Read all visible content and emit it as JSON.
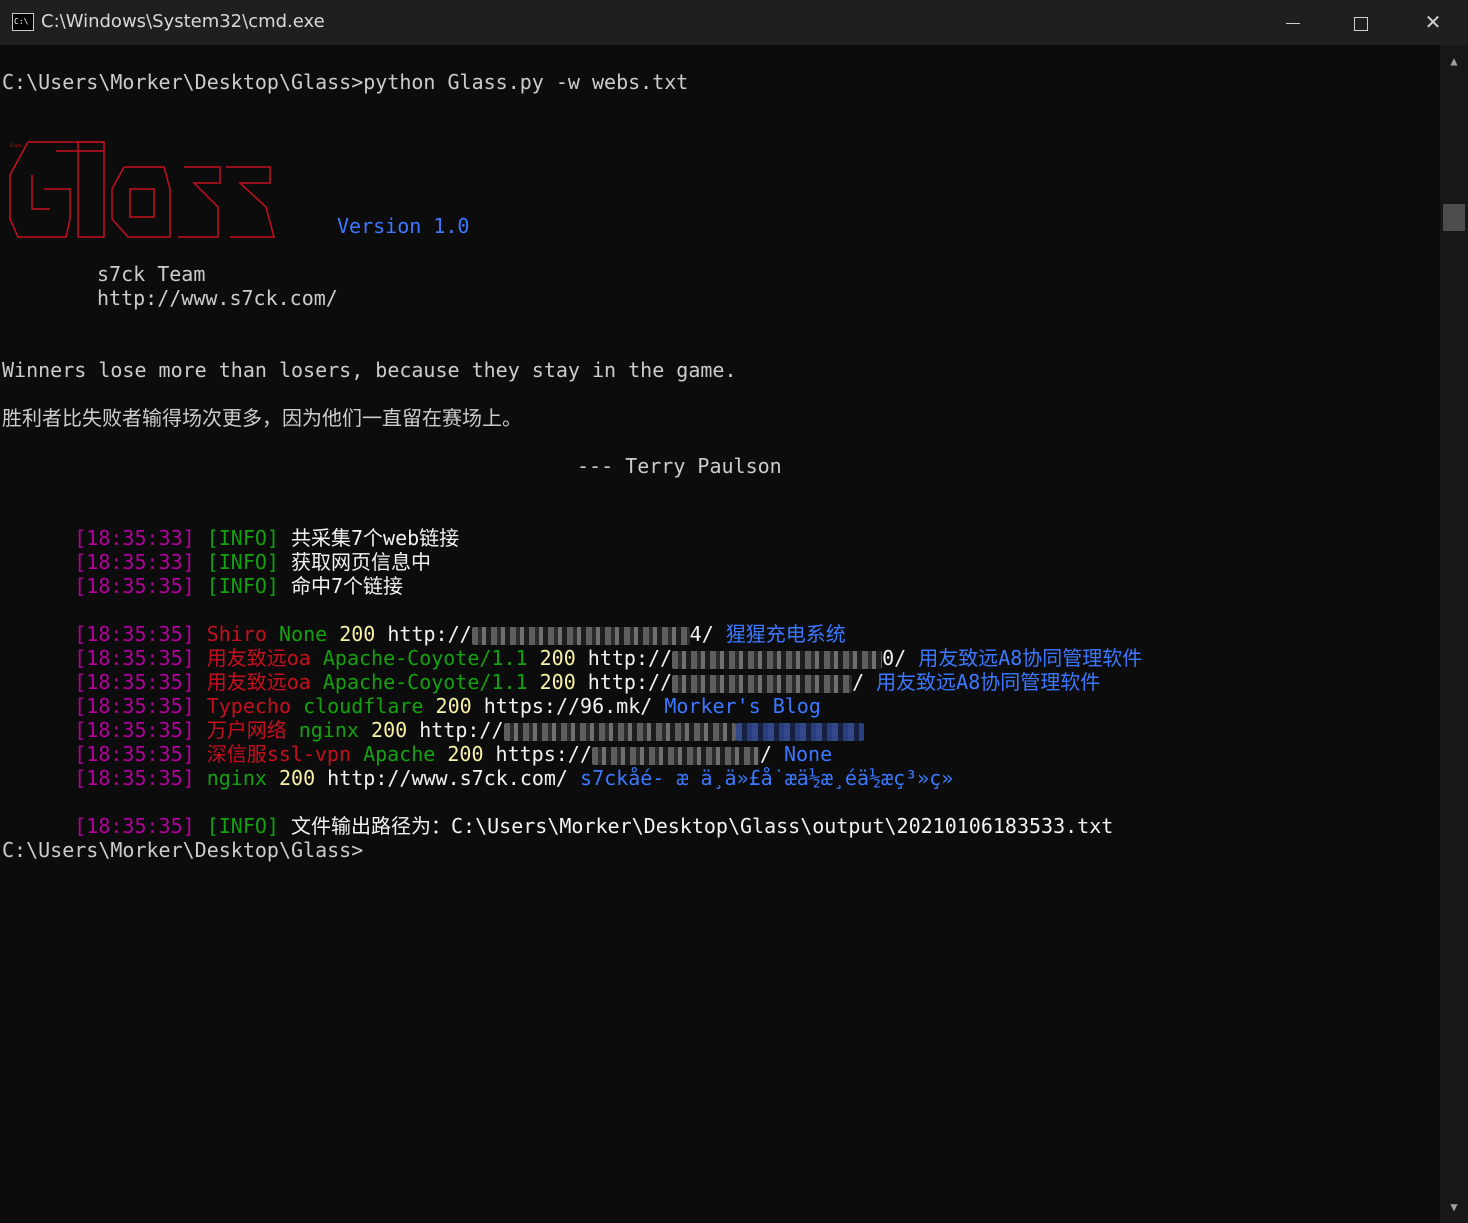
{
  "window": {
    "title": "C:\\Windows\\System32\\cmd.exe",
    "icon": "C:\\",
    "minimize": "minimize",
    "maximize": "maximize",
    "close": "✕"
  },
  "console": {
    "command_line": "C:\\Users\\Morker\\Desktop\\Glass>python Glass.py -w webs.txt",
    "banner": {
      "art": "Glass",
      "version": "Version 1.0",
      "team": "s7ck Team",
      "url": "http://www.s7ck.com/"
    },
    "quote_en": "Winners lose more than losers, because they stay in the game.",
    "quote_cn": "胜利者比失败者输得场次更多，因为他们一直留在赛场上。",
    "quote_author": "--- Terry Paulson",
    "info_lines": [
      {
        "time": "[18:35:33]",
        "tag": "[INFO]",
        "msg": "共采集7个web链接"
      },
      {
        "time": "[18:35:33]",
        "tag": "[INFO]",
        "msg": "获取网页信息中"
      },
      {
        "time": "[18:35:35]",
        "tag": "[INFO]",
        "msg": "命中7个链接"
      }
    ],
    "results": [
      {
        "time": "[18:35:35]",
        "cms": "Shiro",
        "server": "None",
        "code": "200",
        "url_pre": "http://",
        "url_post": "4/",
        "title": "猩猩充电系统"
      },
      {
        "time": "[18:35:35]",
        "cms": "用友致远oa",
        "server": "Apache-Coyote/1.1",
        "code": "200",
        "url_pre": "http://",
        "url_post": "0/",
        "title": "用友致远A8协同管理软件"
      },
      {
        "time": "[18:35:35]",
        "cms": "用友致远oa",
        "server": "Apache-Coyote/1.1",
        "code": "200",
        "url_pre": "http://",
        "url_post": "/",
        "title": "用友致远A8协同管理软件"
      },
      {
        "time": "[18:35:35]",
        "cms": "Typecho",
        "server": "cloudflare",
        "code": "200",
        "url_pre": "https://96.mk/",
        "url_post": "",
        "title": "Morker's Blog"
      },
      {
        "time": "[18:35:35]",
        "cms": "万户网络",
        "server": "nginx",
        "code": "200",
        "url_pre": "http://",
        "url_post": "",
        "title": ""
      },
      {
        "time": "[18:35:35]",
        "cms": "深信服ssl-vpn",
        "server": "Apache",
        "code": "200",
        "url_pre": "https://",
        "url_post": "/",
        "title": "None"
      },
      {
        "time": "[18:35:35]",
        "cms": "nginx",
        "server": "",
        "code": "200",
        "url_pre": "http://www.s7ck.com/",
        "url_post": "",
        "title": "s7ckå\u0001é\u0001\u0001- æ\u0001 ä¸\u0001ä»£å\u0001˙æ\u0001ä½\u0001æ¸\u0001é\u0001\u0001ä½\u0001æ\u0001\u0001ç³»ç»\u0001"
      }
    ],
    "output_line": {
      "time": "[18:35:35]",
      "tag": "[INFO]",
      "msg": "文件输出路径为：C:\\Users\\Morker\\Desktop\\Glass\\output\\20210106183533.txt"
    },
    "prompt": "C:\\Users\\Morker\\Desktop\\Glass>"
  },
  "colors": {
    "background": "#0c0c0c",
    "red": "#c50f1f",
    "magenta": "#b4009e",
    "green": "#13a10e",
    "yellow": "#f9f1a5",
    "blue": "#3b78ff"
  }
}
